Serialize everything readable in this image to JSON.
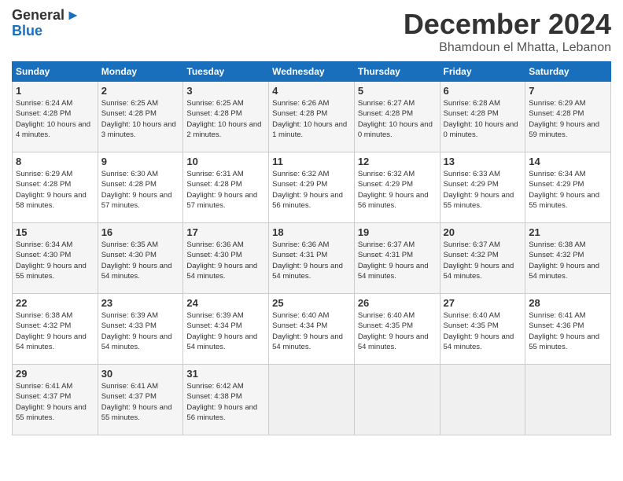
{
  "logo": {
    "general": "General",
    "blue": "Blue"
  },
  "title": "December 2024",
  "location": "Bhamdoun el Mhatta, Lebanon",
  "days_of_week": [
    "Sunday",
    "Monday",
    "Tuesday",
    "Wednesday",
    "Thursday",
    "Friday",
    "Saturday"
  ],
  "weeks": [
    [
      {
        "day": "1",
        "sunrise": "6:24 AM",
        "sunset": "4:28 PM",
        "daylight": "10 hours and 4 minutes."
      },
      {
        "day": "2",
        "sunrise": "6:25 AM",
        "sunset": "4:28 PM",
        "daylight": "10 hours and 3 minutes."
      },
      {
        "day": "3",
        "sunrise": "6:25 AM",
        "sunset": "4:28 PM",
        "daylight": "10 hours and 2 minutes."
      },
      {
        "day": "4",
        "sunrise": "6:26 AM",
        "sunset": "4:28 PM",
        "daylight": "10 hours and 1 minute."
      },
      {
        "day": "5",
        "sunrise": "6:27 AM",
        "sunset": "4:28 PM",
        "daylight": "10 hours and 0 minutes."
      },
      {
        "day": "6",
        "sunrise": "6:28 AM",
        "sunset": "4:28 PM",
        "daylight": "10 hours and 0 minutes."
      },
      {
        "day": "7",
        "sunrise": "6:29 AM",
        "sunset": "4:28 PM",
        "daylight": "9 hours and 59 minutes."
      }
    ],
    [
      {
        "day": "8",
        "sunrise": "6:29 AM",
        "sunset": "4:28 PM",
        "daylight": "9 hours and 58 minutes."
      },
      {
        "day": "9",
        "sunrise": "6:30 AM",
        "sunset": "4:28 PM",
        "daylight": "9 hours and 57 minutes."
      },
      {
        "day": "10",
        "sunrise": "6:31 AM",
        "sunset": "4:28 PM",
        "daylight": "9 hours and 57 minutes."
      },
      {
        "day": "11",
        "sunrise": "6:32 AM",
        "sunset": "4:29 PM",
        "daylight": "9 hours and 56 minutes."
      },
      {
        "day": "12",
        "sunrise": "6:32 AM",
        "sunset": "4:29 PM",
        "daylight": "9 hours and 56 minutes."
      },
      {
        "day": "13",
        "sunrise": "6:33 AM",
        "sunset": "4:29 PM",
        "daylight": "9 hours and 55 minutes."
      },
      {
        "day": "14",
        "sunrise": "6:34 AM",
        "sunset": "4:29 PM",
        "daylight": "9 hours and 55 minutes."
      }
    ],
    [
      {
        "day": "15",
        "sunrise": "6:34 AM",
        "sunset": "4:30 PM",
        "daylight": "9 hours and 55 minutes."
      },
      {
        "day": "16",
        "sunrise": "6:35 AM",
        "sunset": "4:30 PM",
        "daylight": "9 hours and 54 minutes."
      },
      {
        "day": "17",
        "sunrise": "6:36 AM",
        "sunset": "4:30 PM",
        "daylight": "9 hours and 54 minutes."
      },
      {
        "day": "18",
        "sunrise": "6:36 AM",
        "sunset": "4:31 PM",
        "daylight": "9 hours and 54 minutes."
      },
      {
        "day": "19",
        "sunrise": "6:37 AM",
        "sunset": "4:31 PM",
        "daylight": "9 hours and 54 minutes."
      },
      {
        "day": "20",
        "sunrise": "6:37 AM",
        "sunset": "4:32 PM",
        "daylight": "9 hours and 54 minutes."
      },
      {
        "day": "21",
        "sunrise": "6:38 AM",
        "sunset": "4:32 PM",
        "daylight": "9 hours and 54 minutes."
      }
    ],
    [
      {
        "day": "22",
        "sunrise": "6:38 AM",
        "sunset": "4:32 PM",
        "daylight": "9 hours and 54 minutes."
      },
      {
        "day": "23",
        "sunrise": "6:39 AM",
        "sunset": "4:33 PM",
        "daylight": "9 hours and 54 minutes."
      },
      {
        "day": "24",
        "sunrise": "6:39 AM",
        "sunset": "4:34 PM",
        "daylight": "9 hours and 54 minutes."
      },
      {
        "day": "25",
        "sunrise": "6:40 AM",
        "sunset": "4:34 PM",
        "daylight": "9 hours and 54 minutes."
      },
      {
        "day": "26",
        "sunrise": "6:40 AM",
        "sunset": "4:35 PM",
        "daylight": "9 hours and 54 minutes."
      },
      {
        "day": "27",
        "sunrise": "6:40 AM",
        "sunset": "4:35 PM",
        "daylight": "9 hours and 54 minutes."
      },
      {
        "day": "28",
        "sunrise": "6:41 AM",
        "sunset": "4:36 PM",
        "daylight": "9 hours and 55 minutes."
      }
    ],
    [
      {
        "day": "29",
        "sunrise": "6:41 AM",
        "sunset": "4:37 PM",
        "daylight": "9 hours and 55 minutes."
      },
      {
        "day": "30",
        "sunrise": "6:41 AM",
        "sunset": "4:37 PM",
        "daylight": "9 hours and 55 minutes."
      },
      {
        "day": "31",
        "sunrise": "6:42 AM",
        "sunset": "4:38 PM",
        "daylight": "9 hours and 56 minutes."
      },
      null,
      null,
      null,
      null
    ]
  ]
}
